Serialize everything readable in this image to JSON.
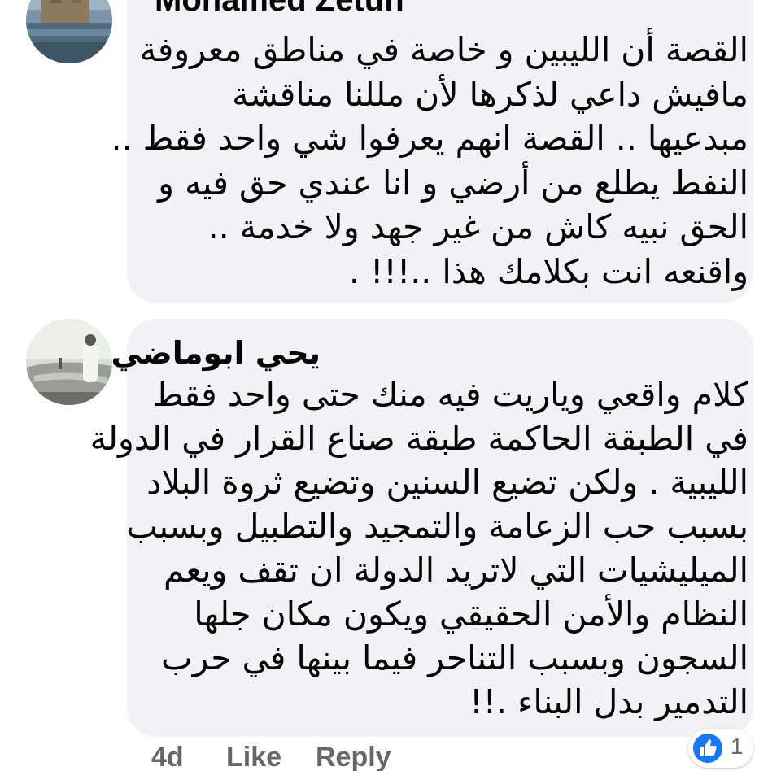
{
  "comments": [
    {
      "author": "Mohamed Zetun",
      "lines": [
        "القصة أن الليبين و خاصة في مناطق معروفة",
        "مافيش داعي لذكرها لأن مللنا مناقشة",
        "مبدعيها .. القصة انهم يعرفوا شي واحد فقط ..",
        "النفط يطلع من أرضي و انا عندي حق فيه و",
        "الحق نبيه كاش من غير جهد ولا خدمة ..",
        "واقنعه انت بكلامك هذا ..!!! ."
      ]
    },
    {
      "author": "يحي ابوماضي",
      "lines": [
        "كلام واقعي وياريت فيه منك حتى واحد فقط",
        "في الطبقة الحاكمة طبقة صناع القرار في الدولة",
        "الليبية . ولكن تضيع السنين وتضيع ثروة البلاد",
        "بسبب حب الزعامة والتمجيد والتطبيل وبسبب",
        "الميليشيات التي لاتريد الدولة ان تقف ويعم",
        "النظام والأمن الحقيقي ويكون مكان جلها",
        "السجون وبسبب التناحر فيما بينها في حرب",
        "التدمير بدل البناء .!!"
      ],
      "actions": {
        "time": "4d",
        "like": "Like",
        "reply": "Reply"
      },
      "reactions": {
        "icon": "like-thumb-icon",
        "count": "1",
        "color": "#1877f2"
      }
    }
  ],
  "colors": {
    "bubble": "#f0f2f5",
    "text": "#050505",
    "muted": "#65676b",
    "accent": "#1877f2"
  }
}
